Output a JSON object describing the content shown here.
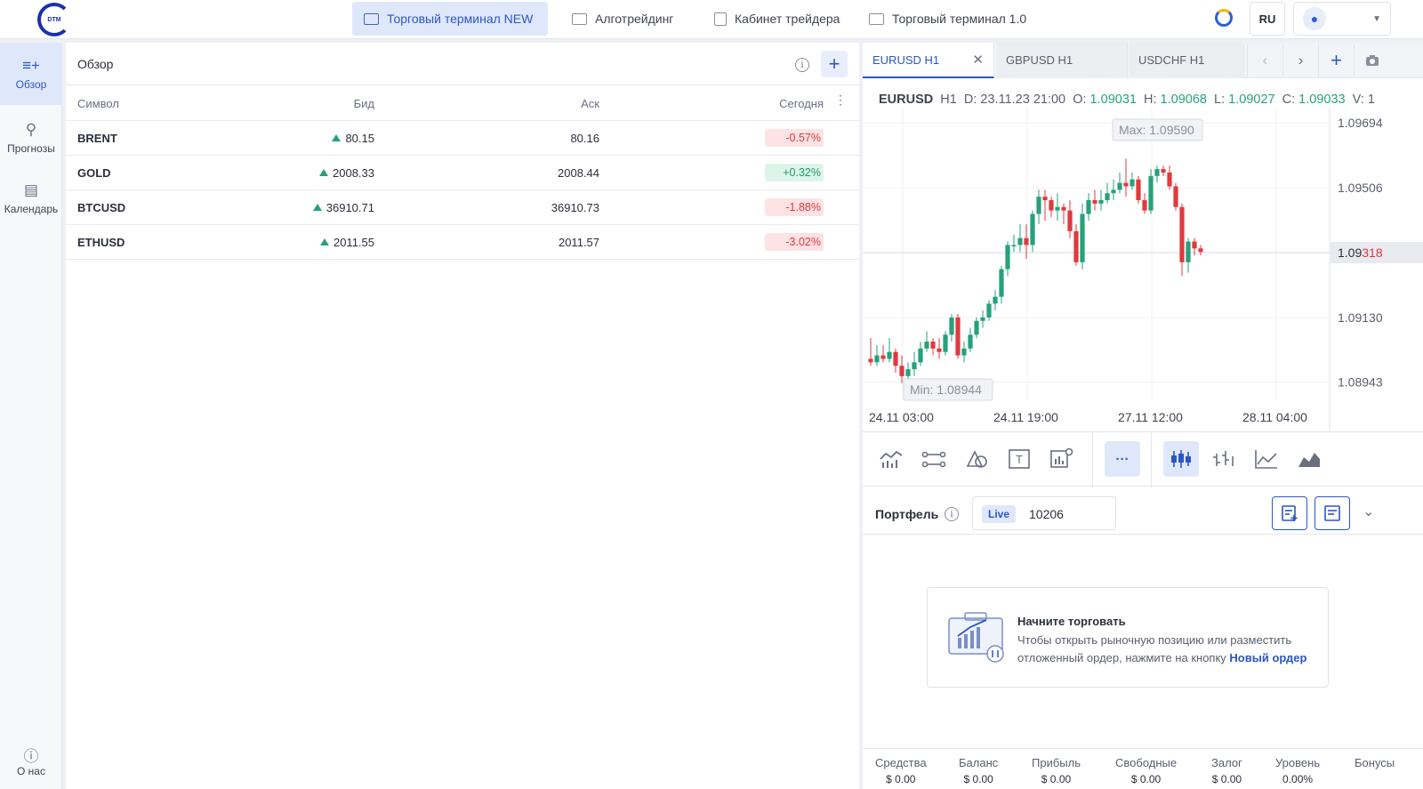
{
  "logo": {
    "text": "DTM"
  },
  "nav": [
    {
      "label": "Торговый терминал NEW",
      "active": true
    },
    {
      "label": "Алготрейдинг",
      "active": false
    },
    {
      "label": "Кабинет трейдера",
      "active": false
    },
    {
      "label": "Торговый терминал 1.0",
      "active": false
    }
  ],
  "header": {
    "lang": "RU",
    "user_icon": "user-icon",
    "theme_icon": "theme-toggle-icon"
  },
  "sidebar": {
    "items": [
      {
        "label": "Обзор",
        "icon": "list-plus-icon",
        "active": true
      },
      {
        "label": "Прогнозы",
        "icon": "search-chart-icon",
        "active": false
      },
      {
        "label": "Календарь",
        "icon": "calendar-icon",
        "active": false
      }
    ],
    "about": "О нас"
  },
  "overview": {
    "title": "Обзор",
    "columns": {
      "symbol": "Символ",
      "bid": "Бид",
      "ask": "Аск",
      "today": "Сегодня"
    },
    "rows": [
      {
        "symbol": "BRENT",
        "bid": "80.15",
        "ask": "80.16",
        "change": "-0.57%",
        "dir": "neg"
      },
      {
        "symbol": "GOLD",
        "bid": "2008.33",
        "ask": "2008.44",
        "change": "+0.32%",
        "dir": "pos"
      },
      {
        "symbol": "BTCUSD",
        "bid": "36910.71",
        "ask": "36910.73",
        "change": "-1.88%",
        "dir": "neg"
      },
      {
        "symbol": "ETHUSD",
        "bid": "2011.55",
        "ask": "2011.57",
        "change": "-3.02%",
        "dir": "neg"
      }
    ]
  },
  "chart_tabs": [
    {
      "label": "EURUSD H1",
      "active": true
    },
    {
      "label": "GBPUSD H1",
      "active": false
    },
    {
      "label": "USDCHF H1",
      "active": false
    }
  ],
  "ohlc": {
    "symbol": "EURUSD",
    "tf": "H1",
    "d": "D: 23.11.23 21:00",
    "o_label": "O:",
    "o": "1.09031",
    "h_label": "H:",
    "h": "1.09068",
    "l_label": "L:",
    "l": "1.09027",
    "c_label": "C:",
    "c": "1.09033",
    "v_label": "V: 1"
  },
  "chart_data": {
    "type": "candlestick",
    "y_ticks": [
      "1.09694",
      "1.09506",
      "1.09318",
      "1.09130",
      "1.08943"
    ],
    "current_price": {
      "prefix": "1.09",
      "suffix": "318"
    },
    "x_ticks": [
      "24.11 03:00",
      "24.11 19:00",
      "27.11 12:00",
      "28.11 04:00"
    ],
    "max_label": "Max: 1.09590",
    "min_label": "Min: 1.08944",
    "ylim": [
      1.0889,
      1.0972
    ],
    "colors": {
      "up": "#26a17b",
      "down": "#e0393e"
    },
    "candles": [
      [
        1.0901,
        1.09,
        1.0907,
        1.0899
      ],
      [
        1.09,
        1.0902,
        1.0905,
        1.0899
      ],
      [
        1.0902,
        1.0901,
        1.0905,
        1.09
      ],
      [
        1.0901,
        1.0903,
        1.0907,
        1.09
      ],
      [
        1.0903,
        1.0899,
        1.0904,
        1.0897
      ],
      [
        1.0899,
        1.0896,
        1.0902,
        1.0894
      ],
      [
        1.0896,
        1.0898,
        1.09,
        1.0895
      ],
      [
        1.0898,
        1.09,
        1.0903,
        1.0896
      ],
      [
        1.09,
        1.0904,
        1.0906,
        1.0899
      ],
      [
        1.0904,
        1.0906,
        1.0909,
        1.0903
      ],
      [
        1.0906,
        1.0904,
        1.0907,
        1.0902
      ],
      [
        1.0904,
        1.0903,
        1.0907,
        1.0901
      ],
      [
        1.0903,
        1.0908,
        1.0909,
        1.0902
      ],
      [
        1.0908,
        1.0913,
        1.0914,
        1.0906
      ],
      [
        1.0913,
        1.0902,
        1.0914,
        1.0901
      ],
      [
        1.0902,
        1.0904,
        1.0906,
        1.09
      ],
      [
        1.0904,
        1.0908,
        1.091,
        1.0903
      ],
      [
        1.0908,
        1.0912,
        1.0913,
        1.0907
      ],
      [
        1.0912,
        1.0913,
        1.0915,
        1.091
      ],
      [
        1.0913,
        1.0917,
        1.0918,
        1.0912
      ],
      [
        1.0917,
        1.0919,
        1.0921,
        1.0915
      ],
      [
        1.0919,
        1.0927,
        1.0928,
        1.0917
      ],
      [
        1.0927,
        1.0934,
        1.0935,
        1.0925
      ],
      [
        1.0934,
        1.0934,
        1.0937,
        1.0932
      ],
      [
        1.0934,
        1.0936,
        1.094,
        1.0932
      ],
      [
        1.0936,
        1.0934,
        1.094,
        1.093
      ],
      [
        1.0934,
        1.0943,
        1.0944,
        1.0932
      ],
      [
        1.0943,
        1.0948,
        1.095,
        1.094
      ],
      [
        1.0948,
        1.0947,
        1.095,
        1.0941
      ],
      [
        1.0947,
        1.0944,
        1.0948,
        1.0942
      ],
      [
        1.0944,
        1.0945,
        1.0949,
        1.0941
      ],
      [
        1.0945,
        1.0944,
        1.0946,
        1.094
      ],
      [
        1.0944,
        1.0938,
        1.0947,
        1.0936
      ],
      [
        1.0938,
        1.0929,
        1.094,
        1.0928
      ],
      [
        1.0929,
        1.0943,
        1.0946,
        1.0927
      ],
      [
        1.0943,
        1.0947,
        1.0949,
        1.0941
      ],
      [
        1.0947,
        1.0946,
        1.095,
        1.0944
      ],
      [
        1.0946,
        1.0947,
        1.095,
        1.0944
      ],
      [
        1.0947,
        1.0949,
        1.0952,
        1.0946
      ],
      [
        1.0949,
        1.095,
        1.0953,
        1.0947
      ],
      [
        1.095,
        1.0952,
        1.0955,
        1.0949
      ],
      [
        1.0952,
        1.0951,
        1.0959,
        1.0948
      ],
      [
        1.0951,
        1.0953,
        1.0955,
        1.095
      ],
      [
        1.0953,
        1.0947,
        1.0954,
        1.0946
      ],
      [
        1.0947,
        1.0944,
        1.0949,
        1.0943
      ],
      [
        1.0944,
        1.0954,
        1.0956,
        1.0943
      ],
      [
        1.0954,
        1.0956,
        1.0957,
        1.0952
      ],
      [
        1.0956,
        1.0955,
        1.0957,
        1.0954
      ],
      [
        1.0955,
        1.0951,
        1.0957,
        1.095
      ],
      [
        1.0951,
        1.0945,
        1.0952,
        1.0944
      ],
      [
        1.0945,
        1.0929,
        1.0946,
        1.0925
      ],
      [
        1.0929,
        1.0935,
        1.0936,
        1.0926
      ],
      [
        1.0935,
        1.0933,
        1.0936,
        1.0931
      ],
      [
        1.0933,
        1.0932,
        1.0934,
        1.0931
      ]
    ]
  },
  "chart_tools": [
    {
      "icon": "indicators-icon",
      "active": false
    },
    {
      "icon": "line-tool-icon",
      "active": false
    },
    {
      "icon": "shapes-icon",
      "active": false
    },
    {
      "icon": "text-tool-icon",
      "active": false
    },
    {
      "icon": "chart-settings-icon",
      "active": false
    },
    {
      "icon": "more-icon",
      "active": true
    },
    {
      "icon": "candles-icon",
      "active": true
    },
    {
      "icon": "bars-icon",
      "active": false
    },
    {
      "icon": "line-chart-icon",
      "active": false
    },
    {
      "icon": "area-chart-icon",
      "active": false
    }
  ],
  "portfolio": {
    "title": "Портфель",
    "account_type": "Live",
    "account_number": "10206",
    "empty_title": "Начните торговать",
    "empty_text": "Чтобы открыть рыночную позицию или разместить отложенный ордер, нажмите на кнопку ",
    "empty_link": "Новый ордер",
    "stats": [
      {
        "label": "Средства",
        "value": "$ 0.00"
      },
      {
        "label": "Баланс",
        "value": "$ 0.00"
      },
      {
        "label": "Прибыль",
        "value": "$ 0.00"
      },
      {
        "label": "Свободные",
        "value": "$ 0.00"
      },
      {
        "label": "Залог",
        "value": "$ 0.00"
      },
      {
        "label": "Уровень",
        "value": "0.00%"
      },
      {
        "label": "Бонусы",
        "value": ""
      }
    ]
  }
}
